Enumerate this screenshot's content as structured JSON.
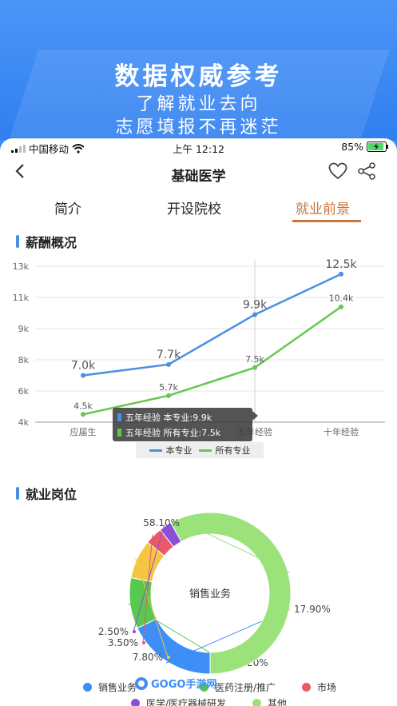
{
  "promo": {
    "headline": "数据权威参考",
    "line1": "了解就业去向",
    "line2": "志愿填报不再迷茫"
  },
  "status_bar": {
    "carrier": "中国移动",
    "time": "上午 12:12",
    "battery": "85%"
  },
  "nav": {
    "title": "基础医学"
  },
  "tabs": [
    {
      "label": "简介",
      "active": false
    },
    {
      "label": "开设院校",
      "active": false
    },
    {
      "label": "就业前景",
      "active": true
    }
  ],
  "salary_section": {
    "title": "薪酬概况"
  },
  "employment_section": {
    "title": "就业岗位"
  },
  "tooltip": {
    "row1": "五年经验 本专业:9.9k",
    "row2": "五年经验 所有专业:7.5k"
  },
  "colors": {
    "accent": "#c9743a",
    "blue": "#4a90e2",
    "green": "#66c750"
  },
  "chart_data": [
    {
      "type": "line",
      "title": "",
      "x": [
        "应届生",
        "",
        "五年经验",
        "十年经验"
      ],
      "y_ticks": [
        "4k",
        "6k",
        "8k",
        "9k",
        "11k",
        "13k"
      ],
      "ylim": [
        4,
        13
      ],
      "series": [
        {
          "name": "本专业",
          "values": [
            7.0,
            7.7,
            9.9,
            12.5
          ],
          "labels": [
            "7.0k",
            "7.7k",
            "9.9k",
            "12.5k"
          ],
          "color": "#4a90e2"
        },
        {
          "name": "所有专业",
          "values": [
            4.5,
            5.7,
            7.5,
            10.4
          ],
          "labels": [
            "4.5k",
            "5.7k",
            "7.5k",
            "10.4k"
          ],
          "color": "#66c750"
        }
      ],
      "legend": "bottom-center",
      "grid": true
    },
    {
      "type": "pie",
      "title": "",
      "center_label": "销售业务",
      "slices": [
        {
          "name": "销售业务",
          "value": 17.9,
          "label": "17.90%",
          "color": "#3e8ef7"
        },
        {
          "name": "医药注册/推广",
          "value": 10.2,
          "label": "10.20%",
          "color": "#58c94f"
        },
        {
          "name": "市场",
          "value": 7.8,
          "label": "7.80%",
          "color": "#f4c542"
        },
        {
          "name": "医药注册",
          "value": 3.5,
          "label": "3.50%",
          "color": "#e85a6a"
        },
        {
          "name": "医学/医疗器械研发",
          "value": 2.5,
          "label": "2.50%",
          "color": "#8b4fd8"
        },
        {
          "name": "其他",
          "value": 58.1,
          "label": "58.10%",
          "color": "#9be27a"
        }
      ]
    }
  ],
  "pie_legend": [
    {
      "label": "销售业务",
      "color": "#3e8ef7"
    },
    {
      "label": "医药注册/推广",
      "color": "#58c94f"
    },
    {
      "label": "市场",
      "color": "#e85a6a"
    },
    {
      "label": "医学/医疗器械研发",
      "color": "#8b4fd8"
    },
    {
      "label": "其他",
      "color": "#9be27a"
    }
  ],
  "watermark": {
    "text": "GOGO手游网"
  }
}
